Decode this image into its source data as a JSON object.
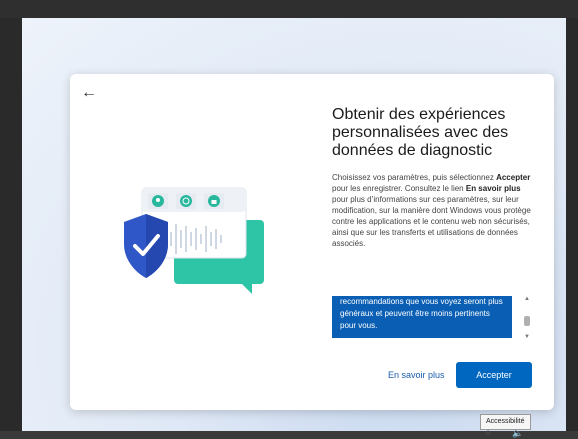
{
  "dialog": {
    "back_icon": "arrow-left-icon",
    "title": "Obtenir des expériences personnalisées avec des données de diagnostic",
    "body_part1": "Choisissez vos paramètres, puis sélectionnez ",
    "body_accept": "Accepter",
    "body_part2": " pour les enregistrer. Consultez le lien ",
    "body_link": "En savoir plus",
    "body_part3": " pour plus d’informations sur ces paramètres, sur leur modification, sur la manière dont Windows vous protège contre les applications et le contenu web non sécurisés, ainsi que sur les transferts et utilisations de données associés.",
    "scroll_text": "recommandations que vous voyez seront plus généraux et peuvent être moins pertinents pour vous.",
    "learn_more": "En savoir plus",
    "accept_button": "Accepter"
  },
  "taskbar": {
    "tooltip": "Accessibilité",
    "accessibility_icon": "accessibility-icon",
    "volume_icon": "speaker-icon"
  },
  "colors": {
    "accent": "#0067c0",
    "highlight": "#0a5fb4",
    "shield": "#2f57c7",
    "teal": "#2ec4a6"
  }
}
